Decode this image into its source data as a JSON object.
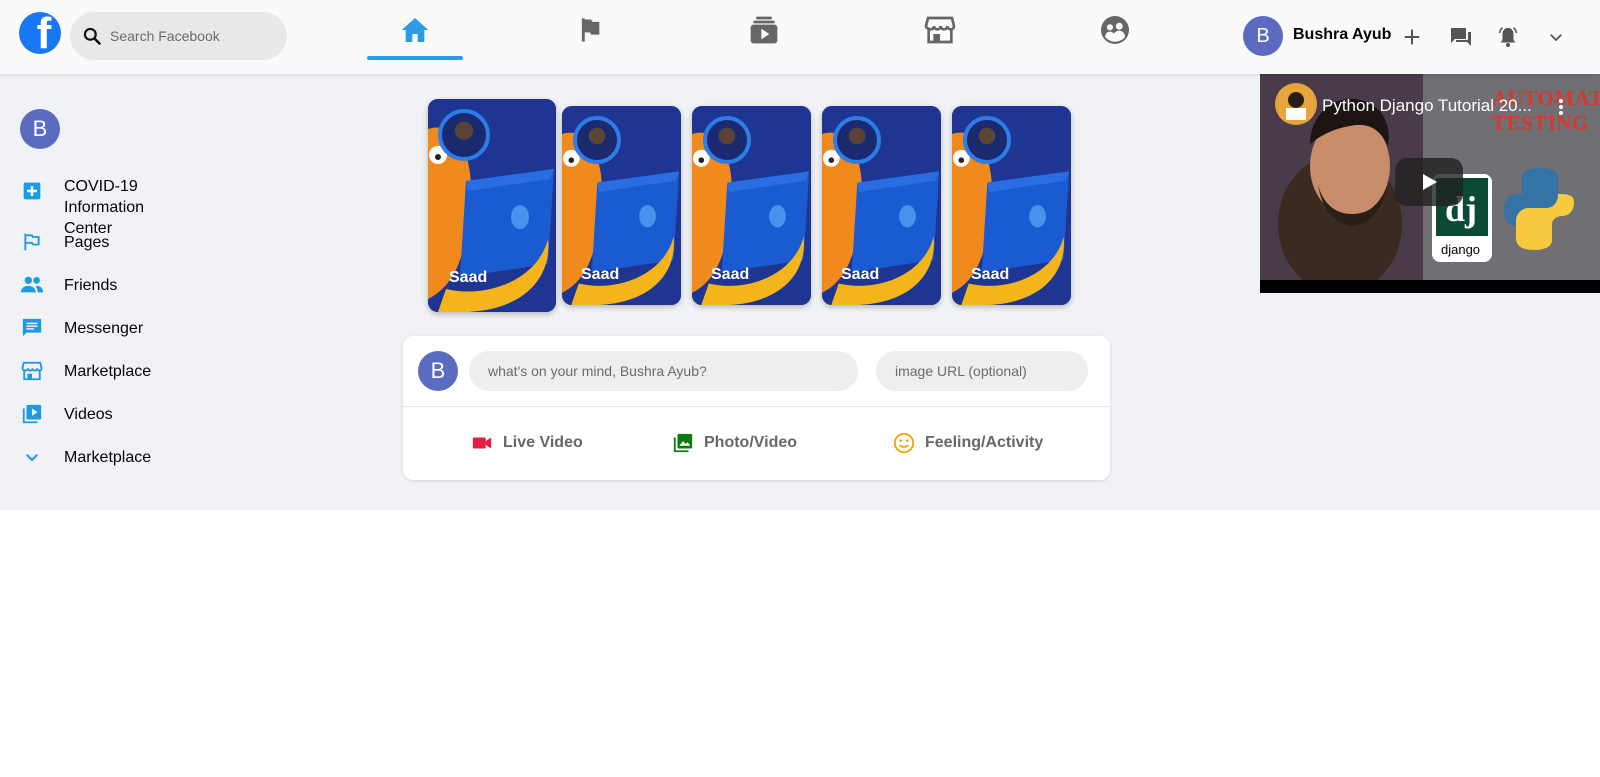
{
  "header": {
    "logo_icon": "facebook-logo",
    "search_placeholder": "Search Facebook",
    "nav": [
      {
        "id": "home",
        "icon": "home-icon",
        "active": true
      },
      {
        "id": "pages",
        "icon": "flag-icon",
        "active": false
      },
      {
        "id": "watch",
        "icon": "video-stack-icon",
        "active": false
      },
      {
        "id": "marketplace",
        "icon": "storefront-icon",
        "active": false
      },
      {
        "id": "groups",
        "icon": "groups-icon",
        "active": false
      }
    ],
    "user": {
      "initial": "B",
      "name": "Bushra Ayub"
    },
    "icons": [
      "plus-icon",
      "messenger-icon",
      "notification-bell-icon",
      "chevron-down-icon"
    ]
  },
  "sidebar": {
    "profile_initial": "B",
    "items": [
      {
        "label": "COVID-19 Information\nCenter",
        "icon": "medical-plus-icon"
      },
      {
        "label": "Pages",
        "icon": "flag-outline-icon"
      },
      {
        "label": "Friends",
        "icon": "people-icon"
      },
      {
        "label": "Messenger",
        "icon": "chat-icon"
      },
      {
        "label": "Marketplace",
        "icon": "storefront-icon"
      },
      {
        "label": "Videos",
        "icon": "video-library-icon"
      },
      {
        "label": "Marketplace",
        "icon": "chevron-down-icon"
      }
    ]
  },
  "stories": [
    {
      "name": "Saad"
    },
    {
      "name": "Saad"
    },
    {
      "name": "Saad"
    },
    {
      "name": "Saad"
    },
    {
      "name": "Saad"
    }
  ],
  "composer": {
    "avatar_initial": "B",
    "message_placeholder": "what's on your mind, Bushra Ayub?",
    "image_placeholder": "image URL (optional)",
    "actions": [
      {
        "label": "Live Video",
        "icon": "videocam-icon",
        "color": "#e41e3f"
      },
      {
        "label": "Photo/Video",
        "icon": "photo-library-icon",
        "color": "#0f7b0f"
      },
      {
        "label": "Feeling/Activity",
        "icon": "smiley-icon",
        "color": "#f0a500"
      }
    ]
  },
  "video": {
    "title": "Python Django Tutorial 20...",
    "overlay_text": "AUTOMATED TESTING",
    "badge_text": "django"
  },
  "colors": {
    "accent": "#2e9be8",
    "fb_blue": "#1877f2",
    "avatar": "#5b6bbf",
    "sidebar_icon": "#1b9be2"
  }
}
